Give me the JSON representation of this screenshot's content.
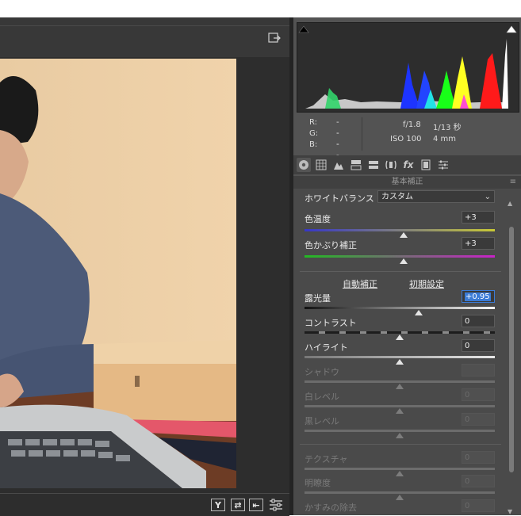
{
  "toolbar": {
    "open_icon": "open-in-icon"
  },
  "readout": {
    "r_label": "R:",
    "r_value": "---",
    "g_label": "G:",
    "g_value": "---",
    "b_label": "B:",
    "b_value": "---",
    "aperture": "f/1.8",
    "shutter": "1/13 秒",
    "iso": "ISO 100",
    "focal": "4 mm"
  },
  "tabs": [
    "basic-icon",
    "tone-curve-icon",
    "detail-icon",
    "hsl-icon",
    "split-toning-icon",
    "lens-icon",
    "fx-icon",
    "camera-calibration-icon",
    "presets-icon"
  ],
  "panel": {
    "section_title": "基本補正",
    "wb_label": "ホワイトバランス :",
    "wb_value": "カスタム",
    "auto_link": "自動補正",
    "default_link": "初期設定",
    "sliders": [
      {
        "label": "色温度",
        "value": "+3",
        "level": 0.52
      },
      {
        "label": "色かぶり補正",
        "value": "+3",
        "level": 0.52
      },
      {
        "label": "露光量",
        "value": "+0.95",
        "level": 0.6
      },
      {
        "label": "コントラスト",
        "value": "0",
        "level": 0.5
      },
      {
        "label": "ハイライト",
        "value": "0",
        "level": 0.5
      },
      {
        "label": "シャドウ",
        "value": "",
        "level": 0.5
      },
      {
        "label": "白レベル",
        "value": "0",
        "level": 0.5
      },
      {
        "label": "黒レベル",
        "value": "0",
        "level": 0.5
      },
      {
        "label": "テクスチャ",
        "value": "0",
        "level": 0.5
      },
      {
        "label": "明瞭度",
        "value": "0",
        "level": 0.5
      },
      {
        "label": "かすみの除去",
        "value": "0",
        "level": 0.5
      }
    ]
  },
  "bottom": {
    "btn1": "Y",
    "btn2": "⇄",
    "btn3": "⇤"
  },
  "colors": {
    "accent": "#3b7bd6",
    "panel": "#4a4a4a",
    "dark": "#2d2d2d"
  }
}
